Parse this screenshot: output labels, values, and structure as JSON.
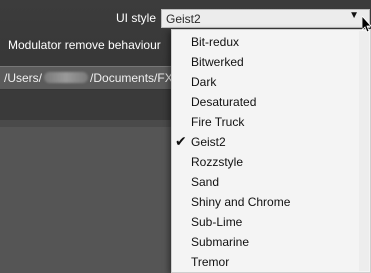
{
  "settings": {
    "ui_style_label": "UI style",
    "ui_style_value": "Geist2",
    "modulator_label": "Modulator remove behaviour",
    "path": {
      "prefix": "/Users/",
      "suffix": "/Documents/FX"
    }
  },
  "dropdown": {
    "selected": "Geist2",
    "arrow_icon": "▼",
    "check_icon": "✔",
    "options": [
      "Bit-redux",
      "Bitwerked",
      "Dark",
      "Desaturated",
      "Fire Truck",
      "Geist2",
      "Rozzstyle",
      "Sand",
      "Shiny and Chrome",
      "Sub-Lime",
      "Submarine",
      "Tremor"
    ]
  },
  "colors": {
    "background": "#3a3a3a",
    "menu_bg": "#f4f4f4",
    "select_bg": "#ececec"
  }
}
